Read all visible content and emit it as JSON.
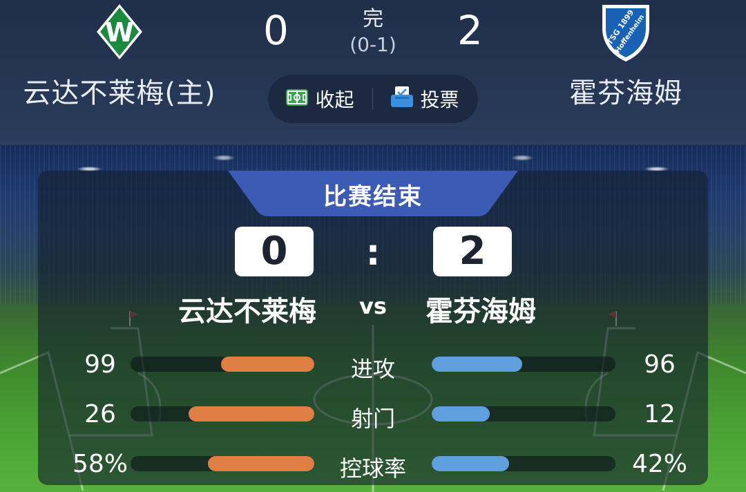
{
  "header": {
    "home_team": {
      "name": "云达不莱梅(主)",
      "score": "0",
      "logo_icon": "werder-bremen-logo-icon"
    },
    "away_team": {
      "name": "霍芬海姆",
      "score": "2",
      "logo_icon": "hoffenheim-logo-icon",
      "logo_text": "TSG 1899 Hoffenheim"
    },
    "status": "完",
    "halftime": "(0-1)",
    "actions": [
      {
        "label": "收起",
        "icon": "pitch-icon"
      },
      {
        "label": "投票",
        "icon": "vote-icon"
      }
    ]
  },
  "panel": {
    "banner": "比赛结束",
    "home_score": "0",
    "away_score": "2",
    "separator": ":",
    "home_name": "云达不莱梅",
    "away_name": "霍芬海姆",
    "vs": "vs",
    "stats": [
      {
        "label": "进攻",
        "home": "99",
        "away": "96",
        "home_value": 99,
        "away_value": 96
      },
      {
        "label": "射门",
        "home": "26",
        "away": "12",
        "home_value": 26,
        "away_value": 12
      },
      {
        "label": "控球率",
        "home": "58%",
        "away": "42%",
        "home_value": 58,
        "away_value": 42
      }
    ]
  },
  "colors": {
    "home_bar": "#df7f44",
    "away_bar": "#5f9fde",
    "banner": "#3b5bb5",
    "header_bg": "#24344f"
  }
}
